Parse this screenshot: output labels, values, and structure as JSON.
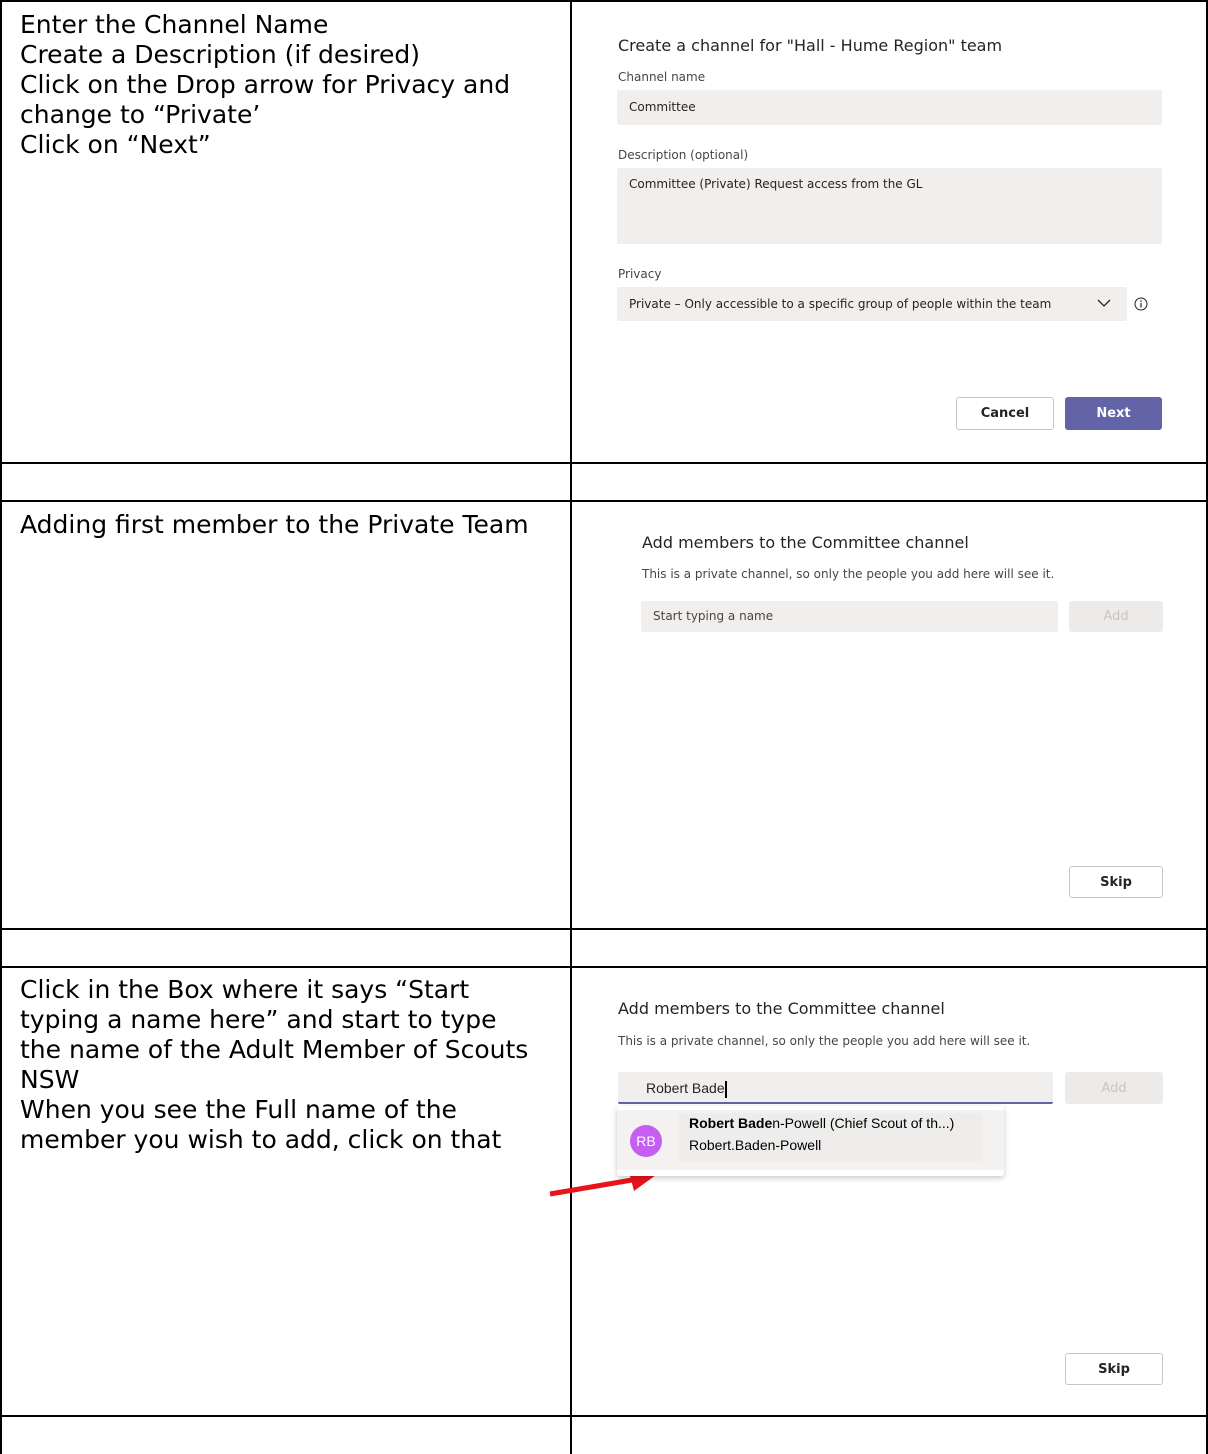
{
  "instructions": {
    "row1": [
      "Enter the Channel Name",
      "Create a Description (if desired)",
      "Click on the Drop arrow for Privacy and",
      "change to “Private’",
      "Click on “Next”"
    ],
    "row2": [
      "Adding first member to the Private Team"
    ],
    "row3": [
      "Click in the Box where it says “Start",
      "typing a name here” and start to type",
      "the name of the Adult Member of Scouts",
      "NSW",
      "When you see the Full name of the",
      "member you wish to add, click on that"
    ]
  },
  "create_channel": {
    "title": "Create a channel for \"Hall - Hume Region\" team",
    "channel_name_label": "Channel name",
    "channel_name_value": "Committee",
    "description_label": "Description (optional)",
    "description_value": "Committee (Private) Request access from the GL",
    "privacy_label": "Privacy",
    "privacy_value": "Private – Only accessible to a specific group of people within the team",
    "cancel_label": "Cancel",
    "next_label": "Next"
  },
  "add_members_empty": {
    "title": "Add members to the Committee channel",
    "subtitle": "This is a private channel, so only the people you add here will see it.",
    "input_placeholder": "Start typing a name",
    "add_label": "Add",
    "skip_label": "Skip"
  },
  "add_members_typing": {
    "title": "Add members to the Committee channel",
    "subtitle": "This is a private channel, so only the people you add here will see it.",
    "input_value": "Robert Bade",
    "add_label": "Add",
    "suggestion": {
      "initials": "RB",
      "name_match": "Robert Bade",
      "name_rest": "n-Powell (Chief Scout of th...)",
      "username": "Robert.Baden-Powell"
    },
    "skip_label": "Skip"
  },
  "colors": {
    "accent": "#6264a7",
    "avatar": "#c75ef2",
    "arrow": "#e8141c"
  }
}
